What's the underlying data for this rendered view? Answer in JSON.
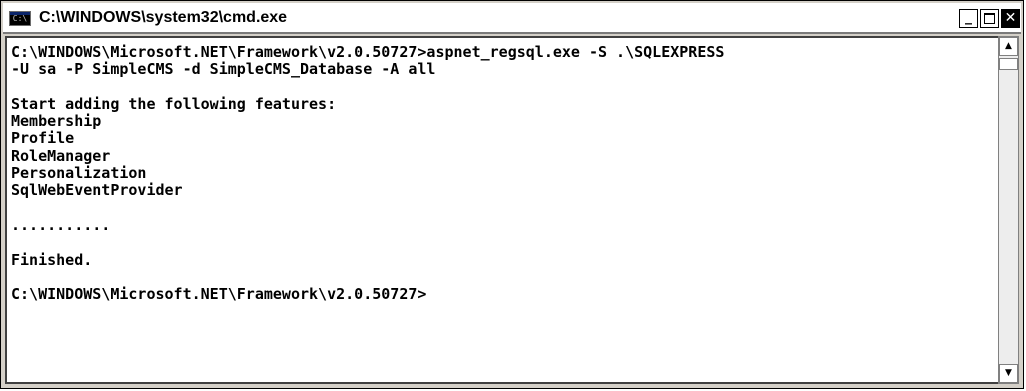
{
  "window": {
    "title": "C:\\WINDOWS\\system32\\cmd.exe",
    "icon_text": "C:\\",
    "icon": "cmd-console-icon",
    "controls": {
      "minimize_icon": "minimize-icon",
      "minimize_glyph": "_",
      "maximize_icon": "maximize-icon",
      "close_icon": "close-icon",
      "close_glyph": "✕"
    }
  },
  "console": {
    "lines": [
      "C:\\WINDOWS\\Microsoft.NET\\Framework\\v2.0.50727>aspnet_regsql.exe -S .\\SQLEXPRESS",
      "-U sa -P SimpleCMS -d SimpleCMS_Database -A all",
      "",
      "Start adding the following features:",
      "Membership",
      "Profile",
      "RoleManager",
      "Personalization",
      "SqlWebEventProvider",
      "",
      "...........",
      "",
      "Finished.",
      "",
      "C:\\WINDOWS\\Microsoft.NET\\Framework\\v2.0.50727>"
    ]
  },
  "scrollbar": {
    "up_arrow": "▲",
    "down_arrow": "▼",
    "up_icon": "scroll-up-arrow-icon",
    "down_icon": "scroll-down-arrow-icon"
  },
  "colors": {
    "console_background": "#ffffff",
    "console_text": "#000000",
    "title_text": "#000000"
  }
}
